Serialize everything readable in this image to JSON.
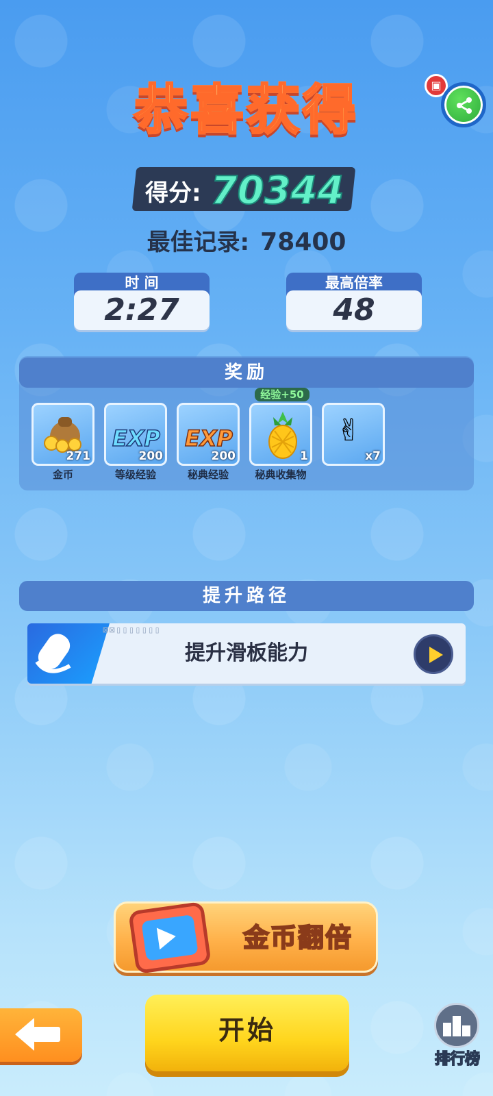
{
  "title": "恭喜获得",
  "score": {
    "label": "得分:",
    "value": "70344"
  },
  "best": {
    "label": "最佳记录:",
    "value": "78400"
  },
  "stats": [
    {
      "label": "时 间",
      "value": "2:27"
    },
    {
      "label": "最高倍率",
      "value": "48"
    }
  ],
  "rewards": {
    "header": "奖励",
    "items": [
      {
        "icon": "coin-bag-icon",
        "count": "271",
        "label": "金币"
      },
      {
        "icon": "exp-icon",
        "text": "EXP",
        "count": "200",
        "label": "等级经验"
      },
      {
        "icon": "exp-icon",
        "text": "EXP",
        "count": "200",
        "label": "秘典经验"
      },
      {
        "icon": "pineapple-icon",
        "count": "1",
        "label": "秘典收集物",
        "badge": "经验+50"
      },
      {
        "icon": "peace-hand-icon",
        "count": "x7",
        "label": ""
      }
    ]
  },
  "upgrade": {
    "header": "提升路径",
    "item_label": "提升滑板能力",
    "code_text": "⊠⊠▯▯▯▯▯▯▯"
  },
  "double_coins_label": "金币翻倍",
  "start_label": "开始",
  "leaderboard_label": "排行榜",
  "colors": {
    "score_value": "#63f0c8",
    "accent_orange": "#ffb14a",
    "start_yellow": "#ffd51d"
  }
}
